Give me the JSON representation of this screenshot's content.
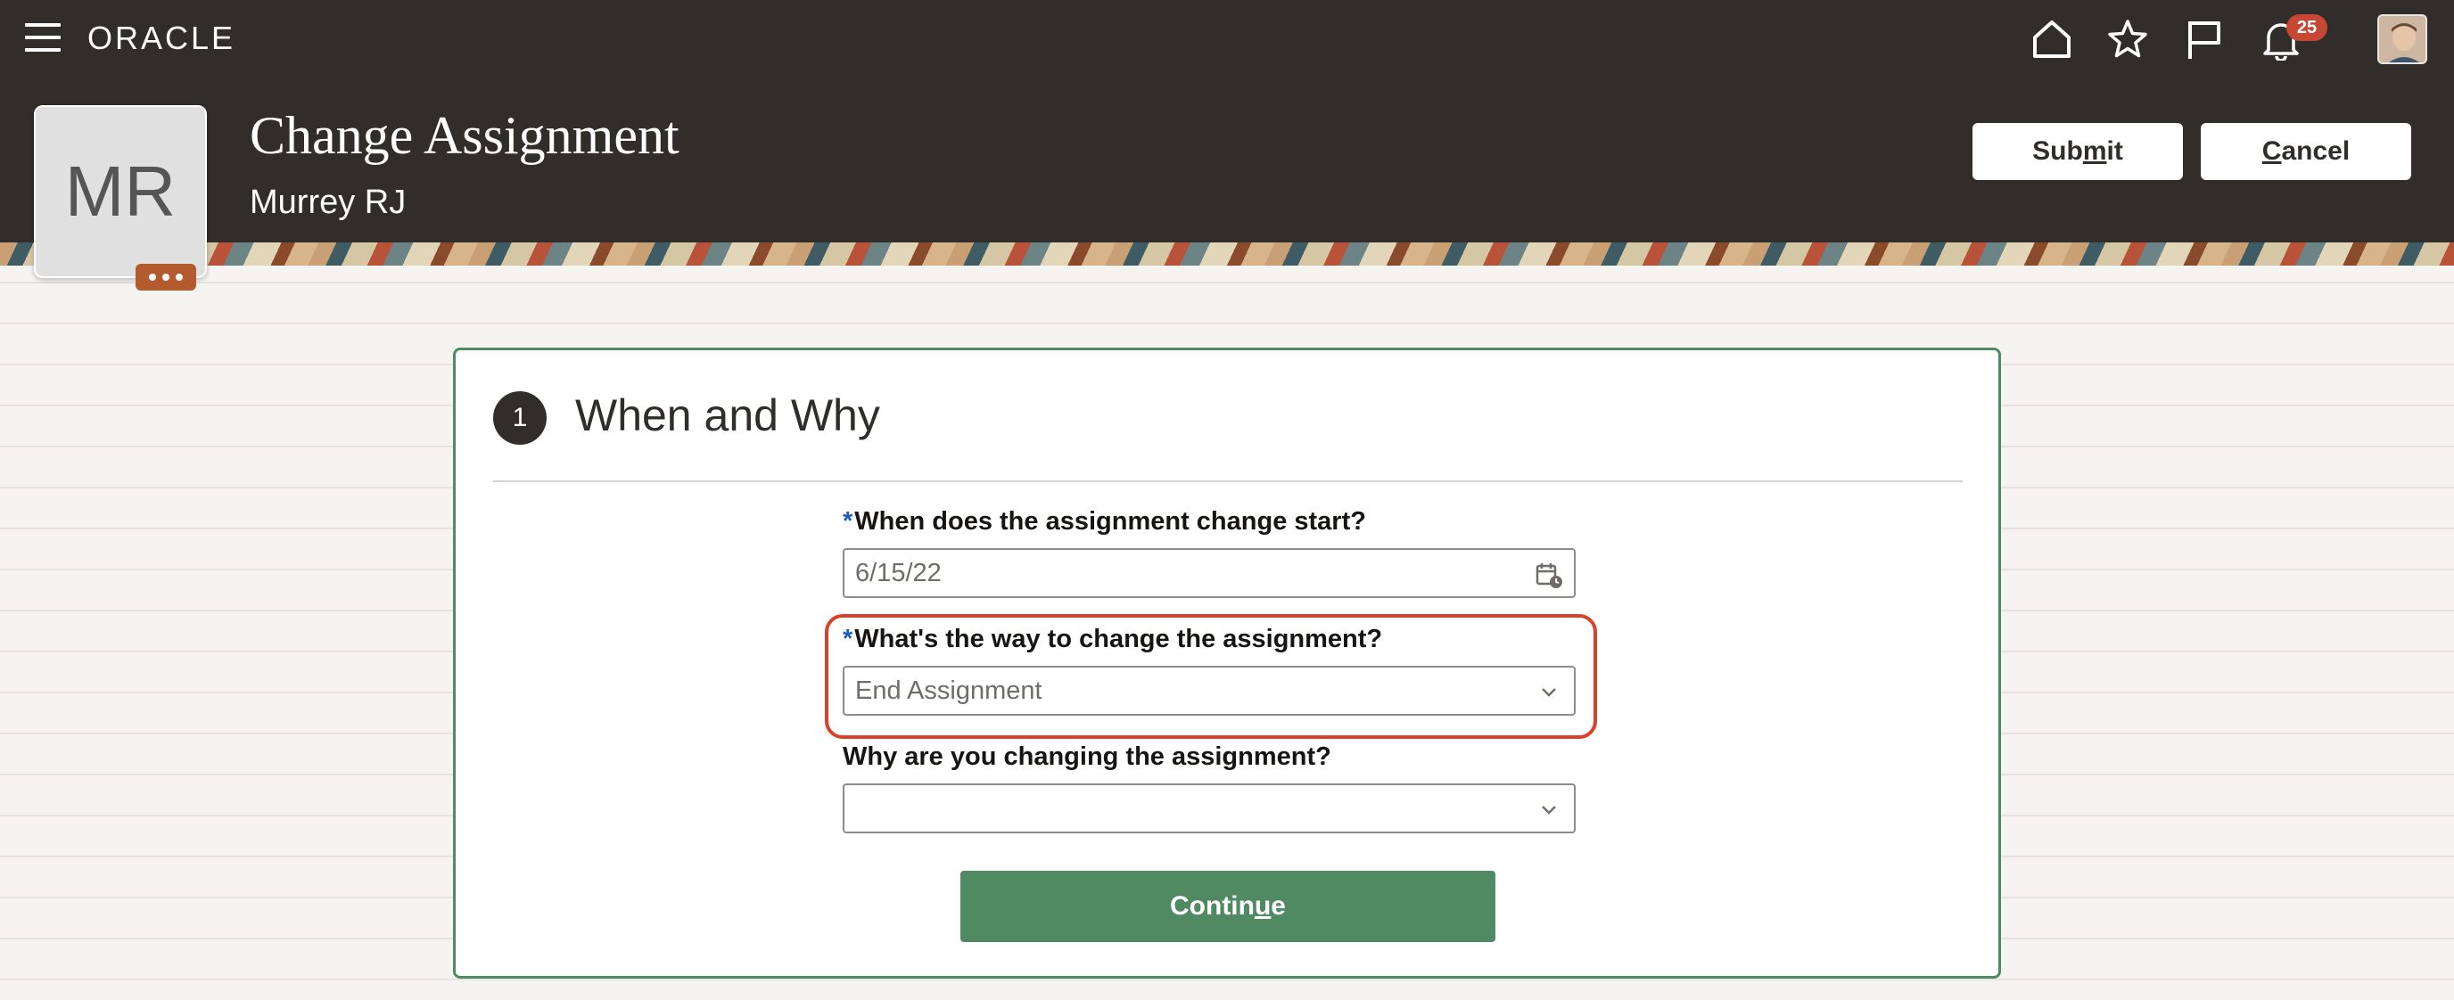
{
  "topbar": {
    "logo": "ORACLE",
    "notifications_count": "25",
    "icons": [
      "menu-icon",
      "home-icon",
      "star-icon",
      "flag-icon",
      "bell-icon"
    ]
  },
  "header": {
    "title": "Change Assignment",
    "person_name": "Murrey RJ",
    "person_initials": "MR",
    "submit_pre": "Sub",
    "submit_ul": "m",
    "submit_post": "it",
    "cancel_ul": "C",
    "cancel_post": "ancel"
  },
  "step": {
    "number": "1",
    "title": "When and Why"
  },
  "form": {
    "start_label": "When does the assignment change start?",
    "start_value": "6/15/22",
    "way_label": "What's the way to change the assignment?",
    "way_value": "End Assignment",
    "why_label": "Why are you changing the assignment?",
    "why_value": "",
    "required_marker": "*",
    "continue_pre": "Contin",
    "continue_ul": "u",
    "continue_post": "e"
  },
  "colors": {
    "header_bg": "#312d2a",
    "accent_green": "#4f8a63",
    "highlight_red": "#d8422a",
    "badge_red": "#c74634"
  }
}
